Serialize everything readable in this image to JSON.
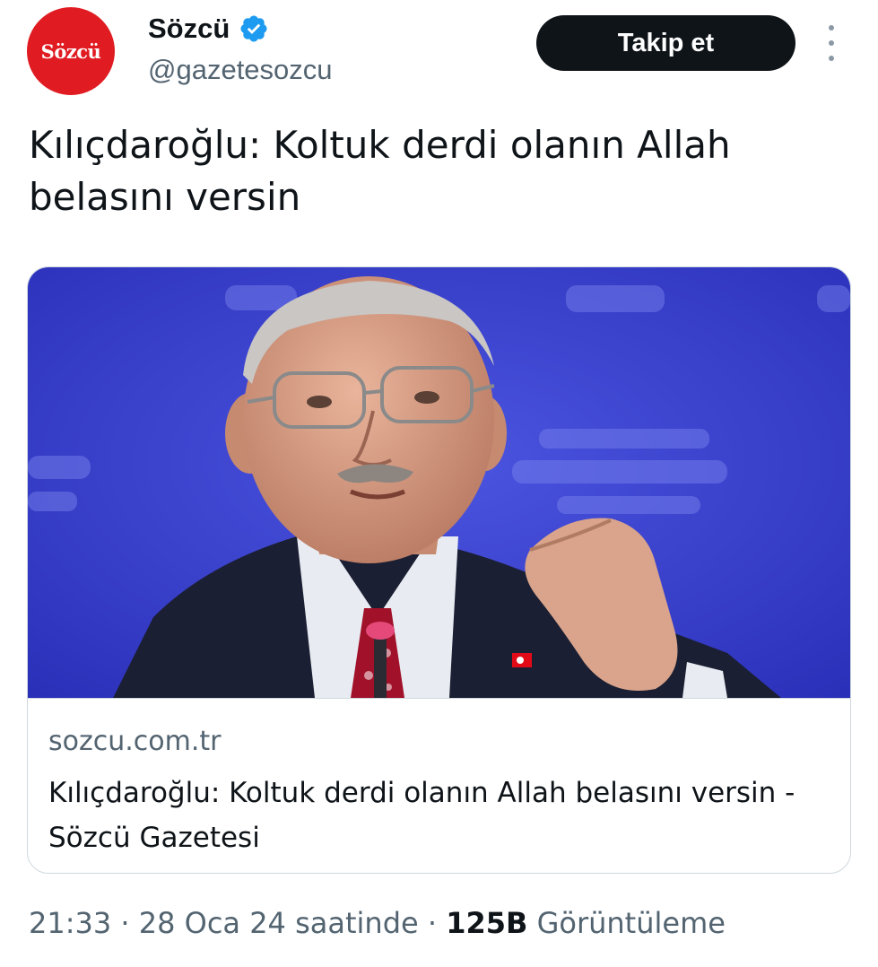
{
  "account": {
    "avatar_logo_text": "Sözcü",
    "display_name": "Sözcü",
    "handle": "@gazetesozcu",
    "verified_icon": "verified-badge-icon",
    "brand_color": "#e01b22",
    "verified_color": "#1d9bf0"
  },
  "actions": {
    "follow_label": "Takip et",
    "more_icon": "more-vertical-icon"
  },
  "tweet": {
    "text": "Kılıçdaroğlu: Koltuk derdi olanın Allah belasını versin"
  },
  "card": {
    "domain": "sozcu.com.tr",
    "title": "Kılıçdaroğlu: Koltuk derdi olanın Allah belasını versin - Sözcü Gazetesi",
    "image_background_color": "#3538c8"
  },
  "meta": {
    "time": "21:33",
    "separator_1": " · ",
    "date": "28 Oca 24 saatinde",
    "separator_2": " · ",
    "views_count": "125B",
    "views_label": " Görüntüleme"
  }
}
